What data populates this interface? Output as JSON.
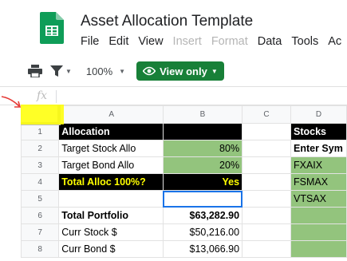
{
  "app": {
    "title": "Asset Allocation Template",
    "menu": [
      "File",
      "Edit",
      "View",
      "Insert",
      "Format",
      "Data",
      "Tools",
      "Ac"
    ]
  },
  "toolbar": {
    "zoom": "100%",
    "view_only_label": "View only"
  },
  "formula_bar": {
    "fx_label": "fx"
  },
  "columns": [
    "A",
    "B",
    "C",
    "D"
  ],
  "rows": [
    "1",
    "2",
    "3",
    "4",
    "5",
    "6",
    "7",
    "8"
  ],
  "cells": {
    "A1": "Allocation",
    "A2": "Target Stock Allo",
    "B2": "80%",
    "A3": "Target Bond Allo",
    "B3": "20%",
    "A4": "Total Alloc 100%?",
    "B4": "Yes",
    "A6": "Total Portfolio",
    "B6": "$63,282.90",
    "A7": "Curr Stock $",
    "B7": "$50,216.00",
    "A8": "Curr Bond $",
    "B8": "$13,066.90",
    "D1": "Stocks",
    "D2": "Enter Sym",
    "D3": "FXAIX",
    "D4": "FSMAX",
    "D5": "VTSAX"
  },
  "colors": {
    "brand_green": "#188038",
    "cell_green": "#93c47d",
    "highlight_yellow": "#ffff00",
    "annotation_red": "#e53935",
    "selection_blue": "#1a73e8"
  }
}
